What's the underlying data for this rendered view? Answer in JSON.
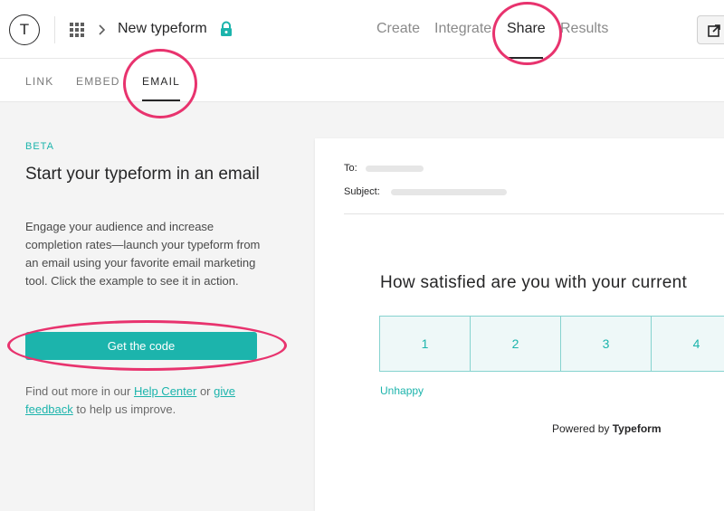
{
  "header": {
    "avatar_letter": "T",
    "form_title": "New typeform",
    "nav": [
      "Create",
      "Integrate",
      "Share",
      "Results"
    ],
    "active_nav": "Share"
  },
  "subtabs": {
    "items": [
      "LINK",
      "EMBED",
      "EMAIL"
    ],
    "active": "EMAIL"
  },
  "email_panel": {
    "badge": "BETA",
    "heading": "Start your typeform in an email",
    "description": "Engage your audience and increase completion rates—launch your typeform from an email using your favorite email marketing tool. Click the example to see it in action.",
    "button_label": "Get the code",
    "help_prefix": "Find out more in our ",
    "help_link": "Help Center",
    "help_or": " or ",
    "feedback_link_a": "give",
    "feedback_link_b": "feedback",
    "help_suffix": " to help us improve."
  },
  "preview": {
    "to_label": "To:",
    "subject_label": "Subject:",
    "question": "How satisfied are you with your current",
    "scale": [
      "1",
      "2",
      "3",
      "4"
    ],
    "low_label": "Unhappy",
    "powered_prefix": "Powered by ",
    "powered_brand": "Typeform"
  },
  "colors": {
    "accent": "#1cb4ac",
    "annotation": "#e8336e",
    "panel_bg": "#f4f4f4"
  },
  "icons": [
    "grid-icon",
    "chevron-right-icon",
    "lock-icon",
    "external-link-icon"
  ]
}
